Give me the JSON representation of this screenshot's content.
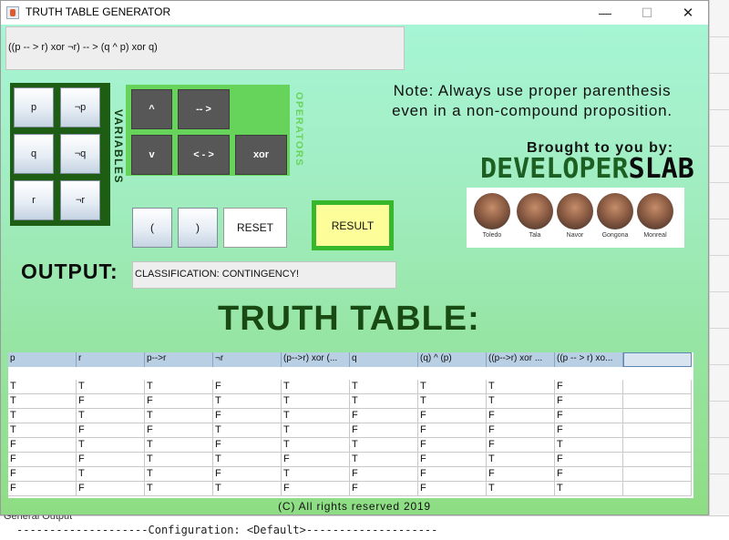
{
  "window": {
    "title": "TRUTH TABLE GENERATOR",
    "minimize": "—",
    "maximize": "☐",
    "close": "✕"
  },
  "expression": "((p -- > r) xor ¬r) -- > (q ^ p) xor q)",
  "variables": {
    "label": "VARIABLES",
    "buttons": [
      "p",
      "¬p",
      "q",
      "¬q",
      "r",
      "¬r"
    ]
  },
  "operators": {
    "label": "OPERATORS",
    "buttons": [
      "^",
      "-- >",
      "v",
      "< - >",
      "xor"
    ]
  },
  "controls": {
    "open_paren": "(",
    "close_paren": ")",
    "reset": "RESET",
    "result": "RESULT"
  },
  "note": {
    "line1": "Note: Always use proper parenthesis",
    "line2": "even in a non-compound proposition."
  },
  "credits": {
    "brought_by": "Brought to you by:",
    "brand_part1": "DEVELOPER",
    "brand_part2": "SLAB",
    "team": [
      "Toledo",
      "Tala",
      "Navor",
      "Gongona",
      "Monreal"
    ]
  },
  "output": {
    "label": "OUTPUT:",
    "value": "CLASSIFICATION: CONTINGENCY!"
  },
  "truth_table": {
    "title": "TRUTH TABLE:",
    "headers": [
      "p",
      "r",
      "p-->r",
      "¬r",
      "(p-->r) xor (...",
      "q",
      "(q) ^ (p)",
      "((p-->r) xor ...",
      "((p -- > r) xo...",
      ""
    ],
    "rows": [
      [
        "T",
        "T",
        "T",
        "F",
        "T",
        "T",
        "T",
        "T",
        "F",
        ""
      ],
      [
        "T",
        "F",
        "F",
        "T",
        "T",
        "T",
        "T",
        "T",
        "F",
        ""
      ],
      [
        "T",
        "T",
        "T",
        "F",
        "T",
        "F",
        "F",
        "F",
        "F",
        ""
      ],
      [
        "T",
        "F",
        "F",
        "T",
        "T",
        "F",
        "F",
        "F",
        "F",
        ""
      ],
      [
        "F",
        "T",
        "T",
        "F",
        "T",
        "T",
        "F",
        "F",
        "T",
        ""
      ],
      [
        "F",
        "F",
        "T",
        "T",
        "F",
        "T",
        "F",
        "T",
        "F",
        ""
      ],
      [
        "F",
        "T",
        "T",
        "F",
        "T",
        "F",
        "F",
        "F",
        "F",
        ""
      ],
      [
        "F",
        "F",
        "T",
        "T",
        "F",
        "F",
        "F",
        "T",
        "T",
        ""
      ]
    ]
  },
  "footer": "(C) All rights reserved 2019",
  "ide": {
    "panel_tab": "General Output",
    "config_line": "--------------------Configuration: <Default>--------------------"
  }
}
